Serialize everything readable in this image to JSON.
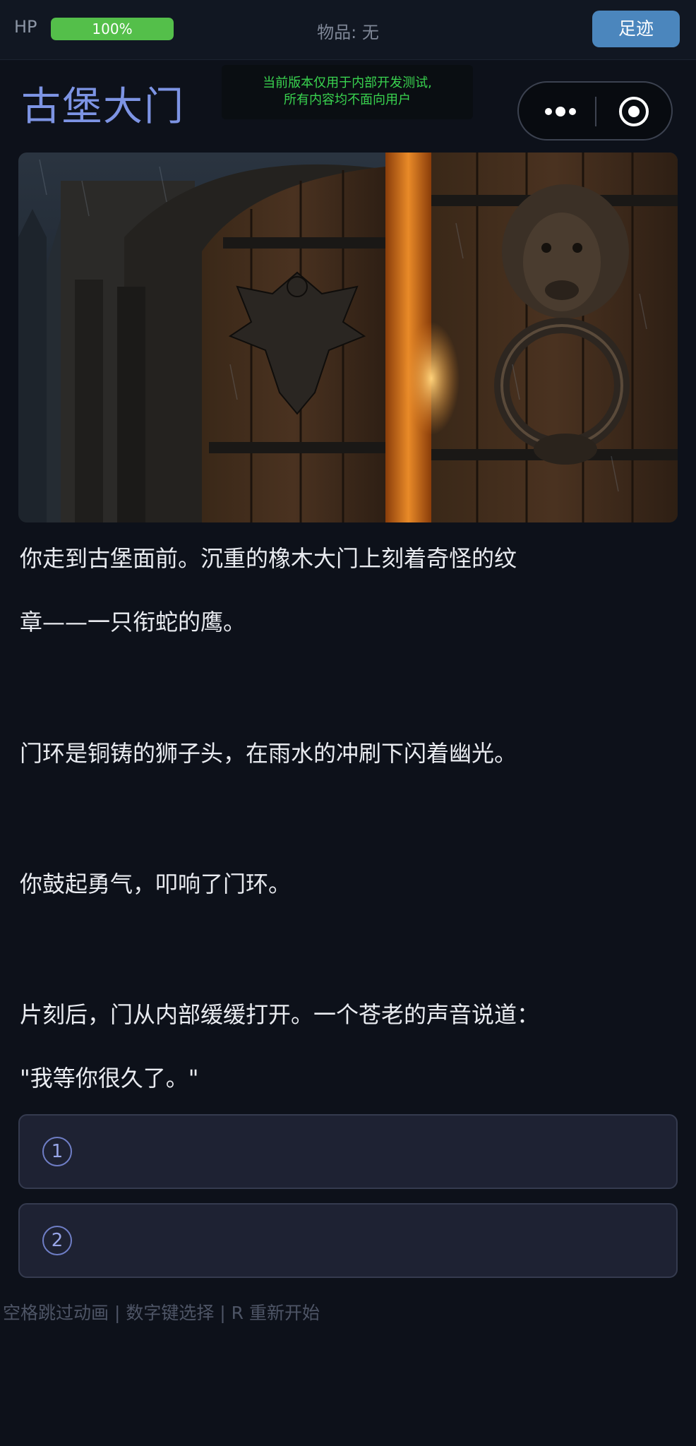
{
  "status_bar": {
    "hp_label": "HP",
    "hp_value": "100%",
    "hp_fraction": 1.0,
    "items_text": "物品: 无",
    "footprint_button": "足迹"
  },
  "dev_notice": {
    "line1": "当前版本仅用于内部开发测试,",
    "line2": "所有内容均不面向用户"
  },
  "scene": {
    "title": "古堡大门",
    "image_icon": "castle-door-lion-knocker-image",
    "story": [
      "你走到古堡面前。沉重的橡木大门上刻着奇怪的纹",
      "章——一只衔蛇的鹰。",
      "门环是铜铸的狮子头，在雨水的冲刷下闪着幽光。",
      "你鼓起勇气，叩响了门环。",
      "片刻后，门从内部缓缓打开。一个苍老的声音说道：",
      "\"我等你很久了。\""
    ]
  },
  "choices": [
    {
      "number": "1",
      "label": ""
    },
    {
      "number": "2",
      "label": ""
    }
  ],
  "hint": "空格跳过动画 | 数字键选择 | R 重新开始",
  "colors": {
    "background": "#0d111a",
    "title": "#7d94e4",
    "hp_fill": "#54bf4a",
    "button": "#4b86bd",
    "notice_text": "#39d34f",
    "choice_bg": "#1e2233"
  }
}
